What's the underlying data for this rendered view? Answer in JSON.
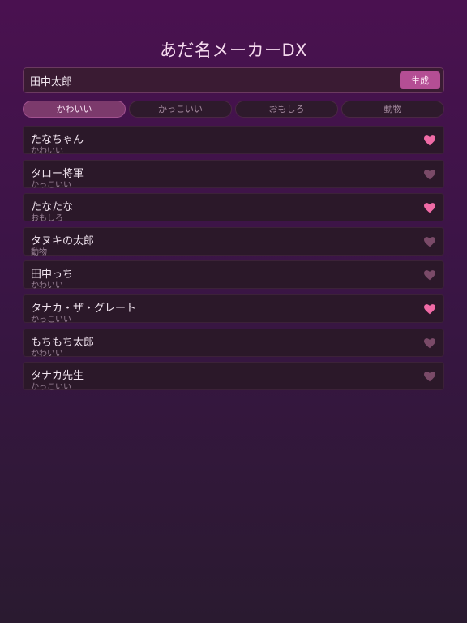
{
  "app": {
    "title": "あだ名メーカーDX"
  },
  "input": {
    "value": "田中太郎",
    "generate_label": "生成"
  },
  "tabs": [
    {
      "label": "かわいい",
      "active": true
    },
    {
      "label": "かっこいい",
      "active": false
    },
    {
      "label": "おもしろ",
      "active": false
    },
    {
      "label": "動物",
      "active": false
    }
  ],
  "colors": {
    "heart_on": "#f06aa6",
    "heart_off": "#7a4a68"
  },
  "nicknames": [
    {
      "name": "たなちゃん",
      "category": "かわいい",
      "favorite": true
    },
    {
      "name": "タロー将軍",
      "category": "かっこいい",
      "favorite": false
    },
    {
      "name": "たなたな",
      "category": "おもしろ",
      "favorite": true
    },
    {
      "name": "タヌキの太郎",
      "category": "動物",
      "favorite": false
    },
    {
      "name": "田中っち",
      "category": "かわいい",
      "favorite": false
    },
    {
      "name": "タナカ・ザ・グレート",
      "category": "かっこいい",
      "favorite": true
    },
    {
      "name": "もちもち太郎",
      "category": "かわいい",
      "favorite": false
    },
    {
      "name": "タナカ先生",
      "category": "かっこいい",
      "favorite": false
    }
  ]
}
